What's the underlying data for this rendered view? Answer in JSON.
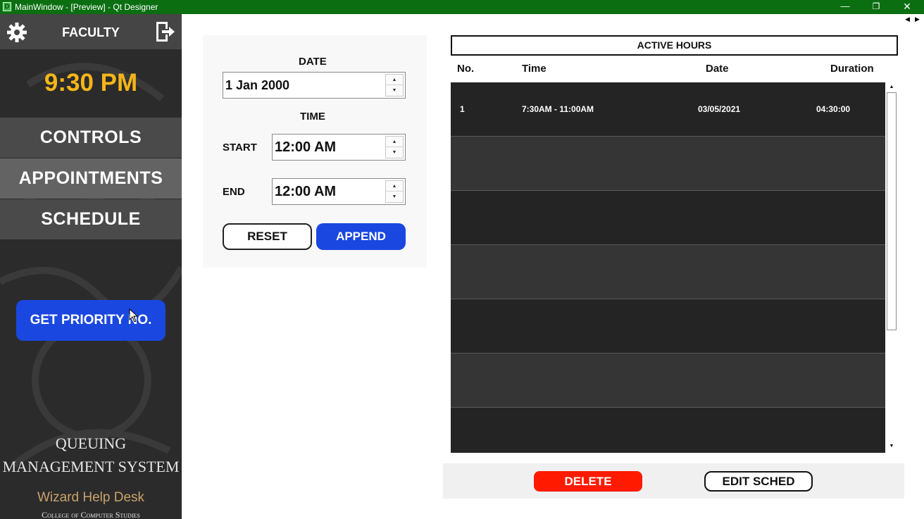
{
  "window": {
    "app_icon": "D",
    "title": "MainWindow - [Preview] - Qt Designer",
    "minimize_glyph": "—",
    "maximize_glyph": "❐",
    "close_glyph": "✕",
    "nav_left_glyph": "◀",
    "nav_right_glyph": "▶"
  },
  "sidebar": {
    "header_label": "FACULTY",
    "settings_icon": "gear-icon",
    "logout_icon": "logout-icon",
    "clock": "9:30 PM",
    "nav": {
      "controls": "CONTROLS",
      "appointments": "APPOINTMENTS",
      "schedule": "SCHEDULE"
    },
    "priority_button": "GET PRIORITY NO.",
    "brand": {
      "line1": "QUEUING",
      "line2": "MANAGEMENT SYSTEM",
      "line3": "Wizard Help Desk",
      "line4": "College of Computer Studies"
    },
    "colors": {
      "accent_clock": "#f5b519",
      "primary_button": "#1a47e0"
    }
  },
  "form": {
    "date_heading": "DATE",
    "date_value": "1 Jan 2000",
    "time_heading": "TIME",
    "start_label": "START",
    "start_value": "12:00 AM",
    "end_label": "END",
    "end_value": "12:00 AM",
    "spin_up_glyph": "▲",
    "spin_down_glyph": "▼",
    "reset_label": "RESET",
    "append_label": "APPEND"
  },
  "active_hours": {
    "title": "ACTIVE HOURS",
    "columns": {
      "no": "No.",
      "time": "Time",
      "date": "Date",
      "duration": "Duration"
    },
    "rows": [
      {
        "no": "1",
        "time": "7:30AM - 11:00AM",
        "date": "03/05/2021",
        "duration": "04:30:00"
      },
      {
        "no": "",
        "time": "",
        "date": "",
        "duration": ""
      },
      {
        "no": "",
        "time": "",
        "date": "",
        "duration": ""
      },
      {
        "no": "",
        "time": "",
        "date": "",
        "duration": ""
      },
      {
        "no": "",
        "time": "",
        "date": "",
        "duration": ""
      },
      {
        "no": "",
        "time": "",
        "date": "",
        "duration": ""
      },
      {
        "no": "",
        "time": "",
        "date": "",
        "duration": ""
      }
    ],
    "scroll_up_glyph": "▲",
    "scroll_down_glyph": "▼"
  },
  "actions": {
    "delete_label": "DELETE",
    "edit_label": "EDIT SCHED",
    "colors": {
      "delete": "#ff1a00"
    }
  }
}
